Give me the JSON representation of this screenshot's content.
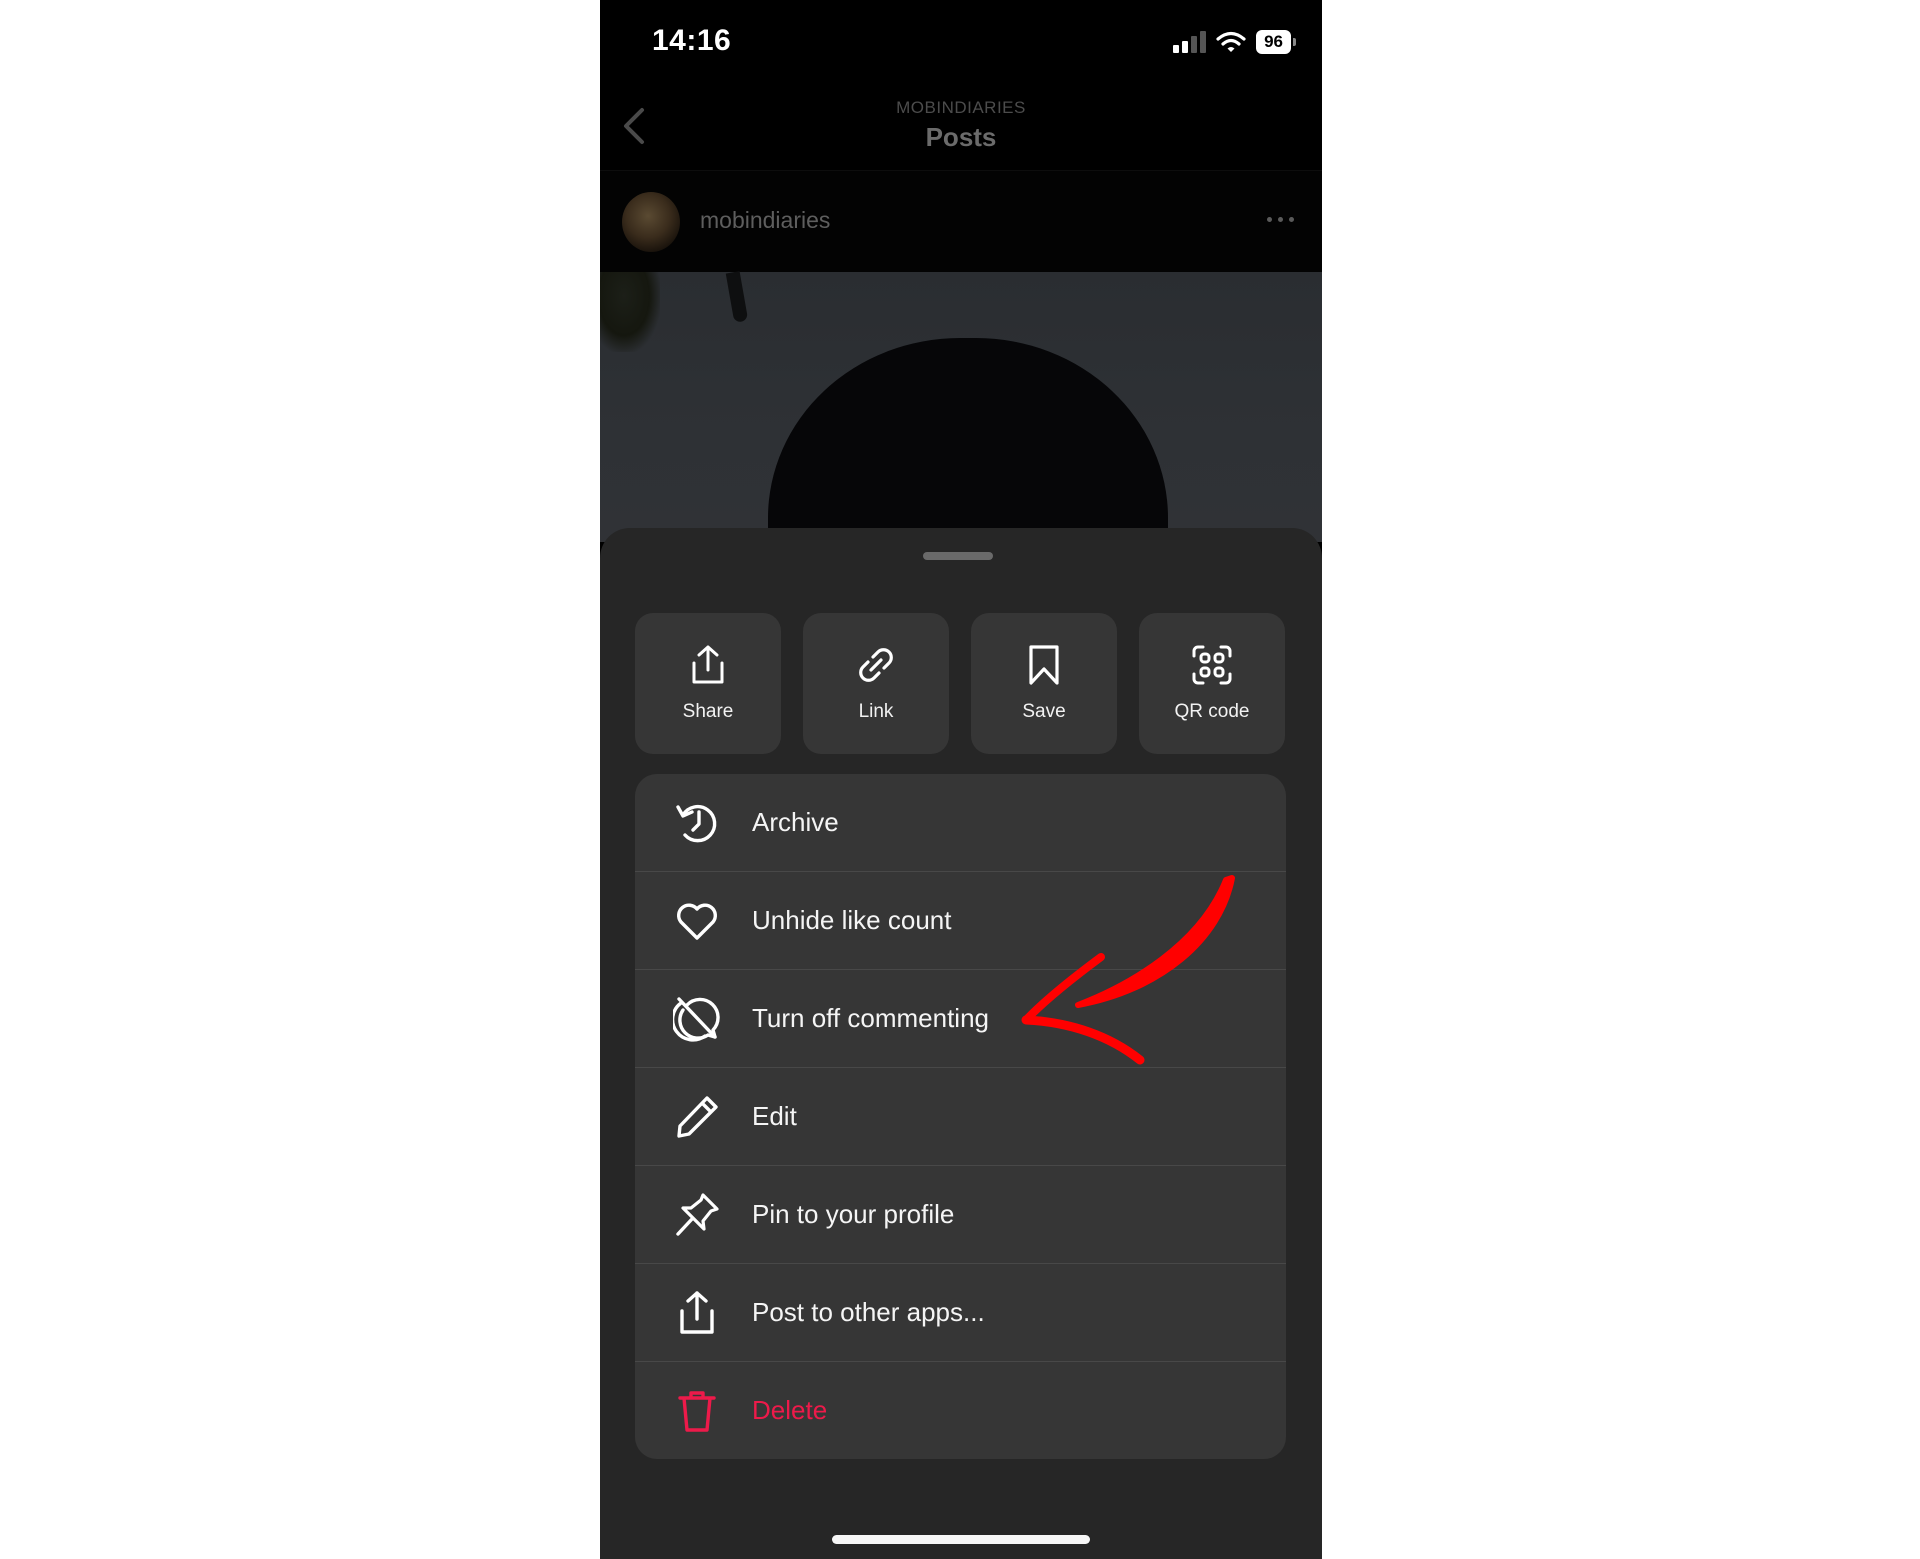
{
  "status_bar": {
    "time": "14:16",
    "signal_bars_active": 2,
    "signal_bars_total": 4,
    "wifi_icon": "wifi-icon",
    "battery_percent": "96"
  },
  "header": {
    "account": "MOBINDIARIES",
    "title": "Posts",
    "back_icon": "chevron-left-icon"
  },
  "post": {
    "username": "mobindiaries",
    "more_icon": "ellipsis-icon"
  },
  "sheet": {
    "quick_actions": [
      {
        "label": "Share",
        "icon": "share-icon"
      },
      {
        "label": "Link",
        "icon": "link-icon"
      },
      {
        "label": "Save",
        "icon": "bookmark-icon"
      },
      {
        "label": "QR code",
        "icon": "qr-code-icon"
      }
    ],
    "menu_items": [
      {
        "label": "Archive",
        "icon": "archive-history-icon"
      },
      {
        "label": "Unhide like count",
        "icon": "heart-icon"
      },
      {
        "label": "Turn off commenting",
        "icon": "comment-off-icon"
      },
      {
        "label": "Edit",
        "icon": "pencil-icon"
      },
      {
        "label": "Pin to your profile",
        "icon": "pin-icon"
      },
      {
        "label": "Post to other apps...",
        "icon": "share-icon"
      },
      {
        "label": "Delete",
        "icon": "trash-icon",
        "destructive": true
      }
    ]
  },
  "annotation": {
    "type": "red-arrow",
    "points_to": "Turn off commenting",
    "color": "#ff0000"
  },
  "colors": {
    "sheet_bg": "#262626",
    "card_bg": "#363636",
    "destructive": "#ed1a4a",
    "text": "#f5f5f5"
  }
}
